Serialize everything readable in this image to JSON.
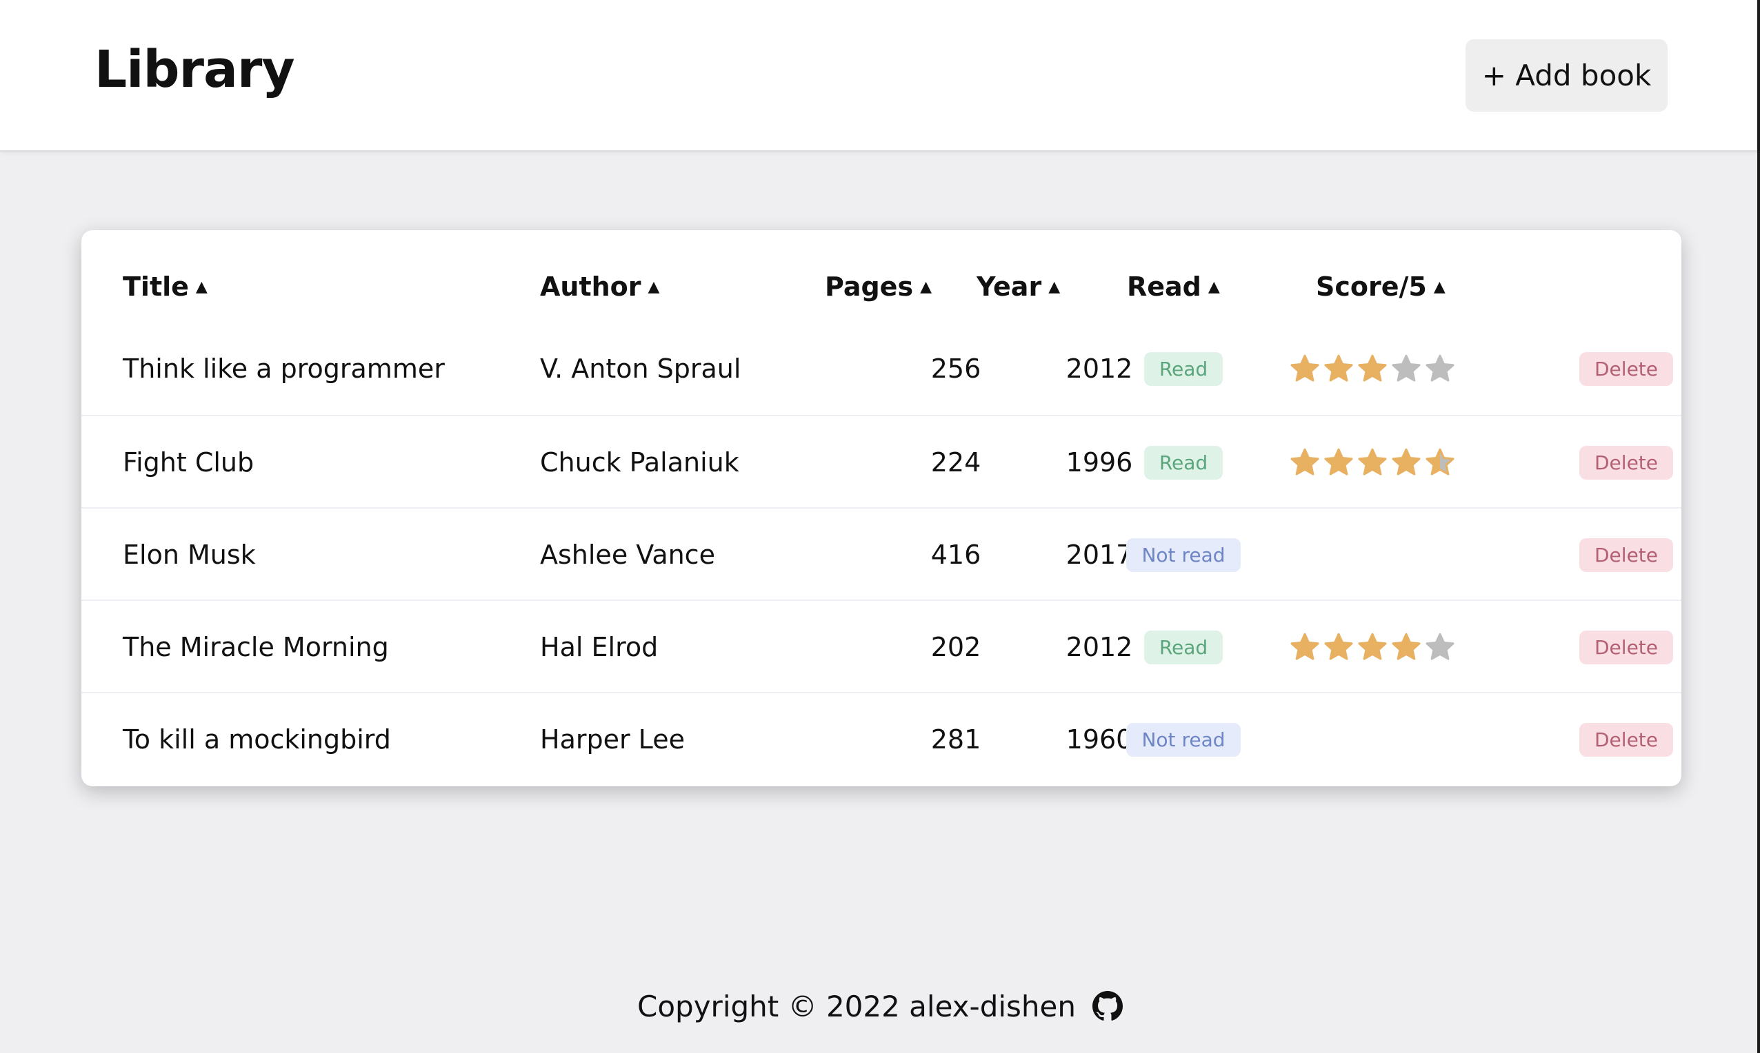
{
  "header": {
    "title": "Library",
    "add_button": "+ Add book"
  },
  "table": {
    "columns": [
      {
        "key": "title",
        "label": "Title",
        "arrow": "▲"
      },
      {
        "key": "author",
        "label": "Author",
        "arrow": "▲"
      },
      {
        "key": "pages",
        "label": "Pages",
        "arrow": "▲"
      },
      {
        "key": "year",
        "label": "Year",
        "arrow": "▲"
      },
      {
        "key": "read",
        "label": "Read",
        "arrow": "▲"
      },
      {
        "key": "score",
        "label": "Score/5",
        "arrow": "▲"
      }
    ],
    "rows": [
      {
        "title": "Think like a programmer",
        "author": "V. Anton Spraul",
        "pages": "256",
        "year": "2012",
        "status": "Read",
        "is_read": true,
        "score": 3,
        "delete": "Delete"
      },
      {
        "title": "Fight Club",
        "author": "Chuck Palaniuk",
        "pages": "224",
        "year": "1996",
        "status": "Read",
        "is_read": true,
        "score": 4.5,
        "delete": "Delete"
      },
      {
        "title": "Elon Musk",
        "author": "Ashlee Vance",
        "pages": "416",
        "year": "2017",
        "status": "Not read",
        "is_read": false,
        "score": null,
        "delete": "Delete"
      },
      {
        "title": "The Miracle Morning",
        "author": "Hal Elrod",
        "pages": "202",
        "year": "2012",
        "status": "Read",
        "is_read": true,
        "score": 4,
        "delete": "Delete"
      },
      {
        "title": "To kill a mockingbird",
        "author": "Harper Lee",
        "pages": "281",
        "year": "1960",
        "status": "Not read",
        "is_read": false,
        "score": null,
        "delete": "Delete"
      }
    ]
  },
  "footer": {
    "text": "Copyright © 2022 alex-dishen",
    "icon": "github-icon"
  },
  "colors": {
    "star_filled": "#e8b061",
    "star_empty": "#bdbdbd"
  }
}
